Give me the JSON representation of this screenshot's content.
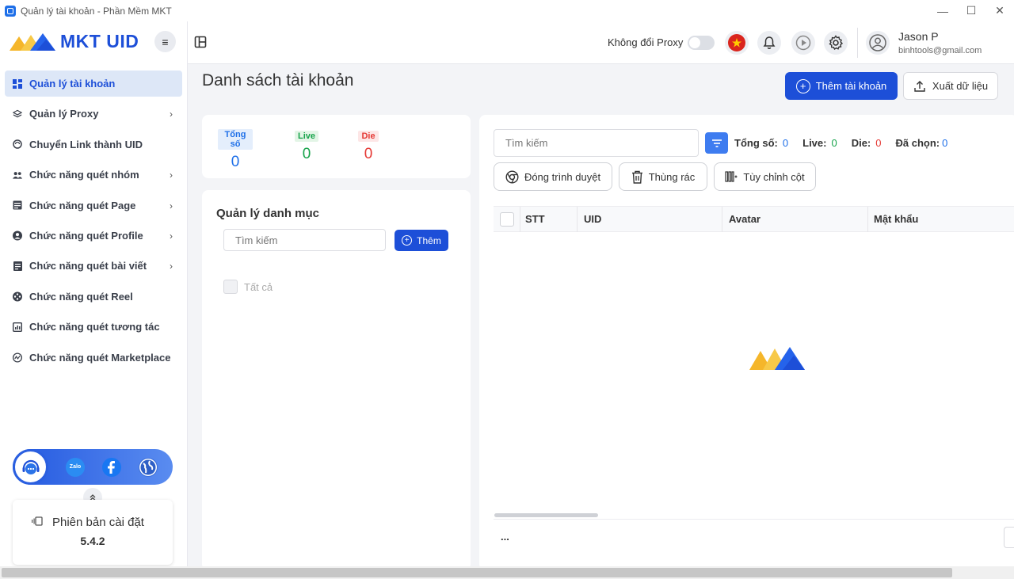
{
  "window": {
    "title": "Quản lý tài khoản - Phần Mềm MKT",
    "controls": {
      "minimize": "—",
      "maximize": "☐",
      "close": "✕"
    }
  },
  "sidebar": {
    "brand": "MKT UID",
    "toggle_icon": "≡",
    "items": [
      {
        "label": "Quản lý tài khoản",
        "icon": "dashboard-icon",
        "active": true,
        "has_submenu": false
      },
      {
        "label": "Quản lý Proxy",
        "icon": "layers-icon",
        "active": false,
        "has_submenu": true
      },
      {
        "label": "Chuyển Link thành UID",
        "icon": "refresh-link-icon",
        "active": false,
        "has_submenu": false
      },
      {
        "label": "Chức năng quét nhóm",
        "icon": "group-icon",
        "active": false,
        "has_submenu": true
      },
      {
        "label": "Chức năng quét Page",
        "icon": "page-icon",
        "active": false,
        "has_submenu": true
      },
      {
        "label": "Chức năng quét Profile",
        "icon": "profile-icon",
        "active": false,
        "has_submenu": true
      },
      {
        "label": "Chức năng quét bài viết",
        "icon": "post-icon",
        "active": false,
        "has_submenu": true
      },
      {
        "label": "Chức năng quét Reel",
        "icon": "reel-icon",
        "active": false,
        "has_submenu": false
      },
      {
        "label": "Chức năng quét tương tác",
        "icon": "interaction-icon",
        "active": false,
        "has_submenu": false
      },
      {
        "label": "Chức năng quét Marketplace",
        "icon": "marketplace-icon",
        "active": false,
        "has_submenu": false
      }
    ],
    "chevron": "›",
    "social": {
      "zalo": "Zalo"
    },
    "version": {
      "label": "Phiên bản cài đặt",
      "number": "5.4.2"
    }
  },
  "header": {
    "proxy_label": "Không đổi Proxy",
    "proxy_enabled": false,
    "user_name": "Jason P",
    "user_email": "binhtools@gmail.com"
  },
  "page": {
    "title": "Danh sách tài khoản",
    "add_account": "Thêm tài khoản",
    "export": "Xuất dữ liệu"
  },
  "stats": {
    "total_label": "Tổng số",
    "total_value": "0",
    "live_label": "Live",
    "live_value": "0",
    "die_label": "Die",
    "die_value": "0"
  },
  "category": {
    "title": "Quản lý danh mục",
    "search_placeholder": "Tìm kiếm",
    "add_label": "Thêm",
    "all_label": "Tất cả"
  },
  "accounts": {
    "search_placeholder": "Tìm kiếm",
    "total_label": "Tổng số:",
    "total_value": "0",
    "live_label": "Live:",
    "live_value": "0",
    "die_label": "Die:",
    "die_value": "0",
    "selected_label": "Đã chọn:",
    "selected_value": "0",
    "close_browser": "Đóng trình duyệt",
    "trash": "Thùng rác",
    "customize_columns": "Tùy chỉnh cột",
    "columns": [
      "STT",
      "UID",
      "Avatar",
      "Mật khẩu"
    ],
    "footer_text": "..."
  },
  "colors": {
    "primary": "#1d4fd8",
    "live": "#16a34a",
    "die": "#e53935",
    "total": "#1e6fe8"
  }
}
